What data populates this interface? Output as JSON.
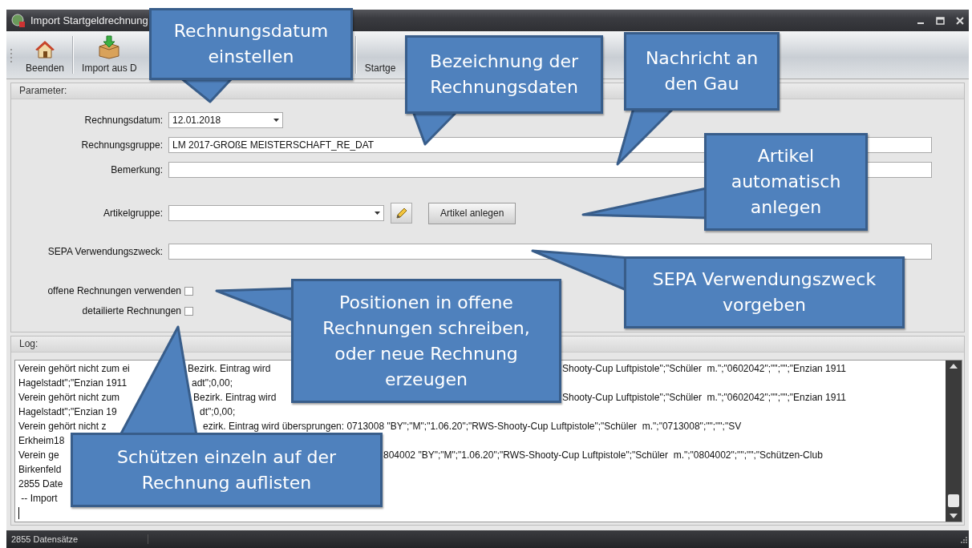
{
  "window": {
    "title": "Import Startgeldrechnung"
  },
  "toolbar": [
    {
      "label": "Beenden",
      "kind": "home"
    },
    {
      "label": "Import aus D",
      "kind": "import"
    },
    {
      "label": "Startge",
      "kind": "plain"
    }
  ],
  "parameter": {
    "title": "Parameter:",
    "fields": [
      {
        "label": "Rechnungsdatum:",
        "kind": "date",
        "value": "12.01.2018"
      },
      {
        "label": "Rechnungsgruppe:",
        "kind": "text",
        "value": "LM 2017-GROßE MEISTERSCHAFT_RE_DAT"
      },
      {
        "label": "Bemerkung:",
        "kind": "text"
      },
      {
        "label": "Artikelgruppe:",
        "kind": "combo",
        "button": "Artikel anlegen"
      },
      {
        "label": "SEPA Verwendungszweck:",
        "kind": "text"
      }
    ],
    "checkboxes": [
      {
        "label": "offene Rechnungen verwenden",
        "checked": false
      },
      {
        "label": "detailierte Rechnungen",
        "checked": false
      }
    ]
  },
  "log": {
    "title": "Log:",
    "lines": [
      {
        "parts": [
          "Verein gehört nicht zum ei",
          "Bezirk. Eintrag wird",
          "Shooty-Cup Luftpistole\";\"Schüler  m.\";\"0602042\";\"\";\"\";\"Enzian 1911"
        ]
      },
      {
        "parts": [
          "Hagelstadt\";\"Enzian 1911",
          "adt\";0,00;"
        ]
      },
      {
        "parts": [
          "Verein gehört nicht zum",
          "Bezirk. Eintrag wird",
          "Shooty-Cup Luftpistole\";\"Schüler  m.\";\"0602042\";\"\";\"\";\"Enzian 1911"
        ]
      },
      {
        "parts": [
          "Hagelstadt\";\"Enzian 19",
          "dt\";0,00;"
        ]
      },
      {
        "parts": [
          "Verein gehört nicht z",
          "ezirk. Eintrag wird übersprungen: 0713008 \"BY\";\"M\";\"1.06.20\";\"RWS-Shooty-Cup Luftpistole\";\"Schüler  m.\";\"0713008\";\"\";\"\";\"SV"
        ]
      },
      {
        "parts": [
          "Erkheim18"
        ]
      },
      {
        "parts": [
          "Verein ge",
          "804002 \"BY\";\"M\";\"1.06.20\";\"RWS-Shooty-Cup Luftpistole\";\"Schüler  m.\";\"0804002\";\"\";\"\";\"Schützen-Club"
        ]
      },
      {
        "parts": [
          "Birkenfeld"
        ]
      },
      {
        "parts": [
          "2855 Date"
        ]
      },
      {
        "parts": [
          " -- Import"
        ]
      }
    ]
  },
  "status_bar": {
    "text": "2855 Datensätze"
  },
  "callouts": [
    {
      "text": "Rechnungsdatum einstellen"
    },
    {
      "text": "Bezeichnung der Rechnungsdaten"
    },
    {
      "text": "Nachricht an den Gau"
    },
    {
      "text": "Artikel automatisch anlegen"
    },
    {
      "text": "SEPA Verwendungszweck vorgeben"
    },
    {
      "text": "Positionen in offene Rechnungen schreiben, oder neue Rechnung erzeugen"
    },
    {
      "text": "Schützen einzeln auf der Rechnung auflisten"
    }
  ]
}
